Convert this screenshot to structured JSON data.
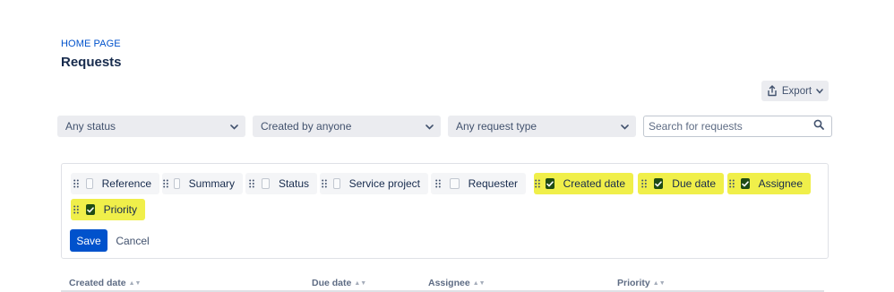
{
  "breadcrumb": "HOME PAGE",
  "title": "Requests",
  "export": {
    "label": "Export",
    "icon": "share-icon",
    "chevron": "chevron-down-icon"
  },
  "filters": [
    {
      "value": "Any status"
    },
    {
      "value": "Created by anyone"
    },
    {
      "value": "Any request type"
    }
  ],
  "search": {
    "placeholder": "Search for requests",
    "value": ""
  },
  "columns_panel": {
    "chips": [
      {
        "label": "Reference",
        "checked": false,
        "highlighted": false
      },
      {
        "label": "Summary",
        "checked": false,
        "highlighted": false
      },
      {
        "label": "Status",
        "checked": false,
        "highlighted": false
      },
      {
        "label": "Service project",
        "checked": false,
        "highlighted": false
      },
      {
        "label": "Requester",
        "checked": false,
        "highlighted": false
      },
      {
        "label": "Created date",
        "checked": true,
        "highlighted": true
      },
      {
        "label": "Due date",
        "checked": true,
        "highlighted": true
      },
      {
        "label": "Assignee",
        "checked": true,
        "highlighted": true
      },
      {
        "label": "Priority",
        "checked": true,
        "highlighted": true
      }
    ],
    "save_label": "Save",
    "cancel_label": "Cancel"
  },
  "table": {
    "headers": [
      "Created date",
      "Due date",
      "Assignee",
      "Priority"
    ]
  },
  "colors": {
    "accent": "#0052cc",
    "highlight": "#f0ef4a",
    "checkbox_checked": "#1f4b15"
  }
}
